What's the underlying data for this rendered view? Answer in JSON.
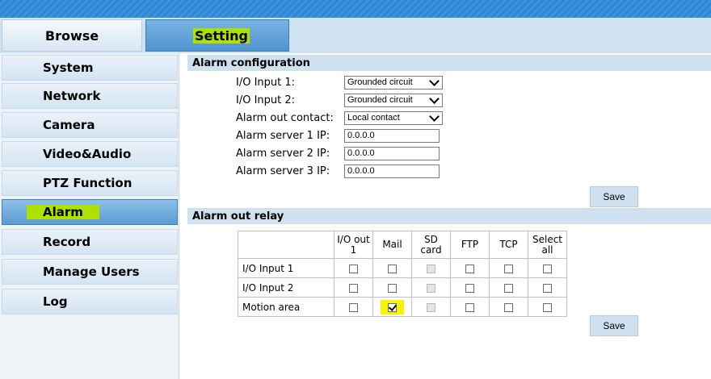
{
  "tabs": {
    "browse": "Browse",
    "setting": "Setting"
  },
  "sidebar": {
    "items": [
      {
        "label": "System"
      },
      {
        "label": "Network"
      },
      {
        "label": "Camera"
      },
      {
        "label": "Video&Audio"
      },
      {
        "label": "PTZ Function"
      },
      {
        "label": "Alarm"
      },
      {
        "label": "Record"
      },
      {
        "label": "Manage Users"
      },
      {
        "label": "Log"
      }
    ]
  },
  "alarm_config": {
    "title": "Alarm configuration",
    "io_input_1": {
      "label": "I/O Input 1:",
      "value": "Grounded circuit"
    },
    "io_input_2": {
      "label": "I/O Input 2:",
      "value": "Grounded circuit"
    },
    "alarm_out_contact": {
      "label": "Alarm out contact:",
      "value": "Local contact"
    },
    "server1": {
      "label": "Alarm server 1 IP:",
      "value": "0.0.0.0"
    },
    "server2": {
      "label": "Alarm server 2 IP:",
      "value": "0.0.0.0"
    },
    "server3": {
      "label": "Alarm server 3 IP:",
      "value": "0.0.0.0"
    },
    "save_label": "Save"
  },
  "alarm_relay": {
    "title": "Alarm out relay",
    "columns": [
      "I/O out 1",
      "Mail",
      "SD card",
      "FTP",
      "TCP",
      "Select all"
    ],
    "rows": [
      {
        "label": "I/O Input 1",
        "checks": [
          false,
          false,
          false,
          false,
          false,
          false
        ]
      },
      {
        "label": "I/O Input 2",
        "checks": [
          false,
          false,
          false,
          false,
          false,
          false
        ]
      },
      {
        "label": "Motion area",
        "checks": [
          false,
          true,
          false,
          false,
          false,
          false
        ]
      }
    ],
    "disabled_column": "SD card",
    "save_label": "Save"
  },
  "colors": {
    "highlight_green": "#aee000",
    "highlight_yellow": "#f5f500",
    "active_tab": "#5b9cd4"
  }
}
